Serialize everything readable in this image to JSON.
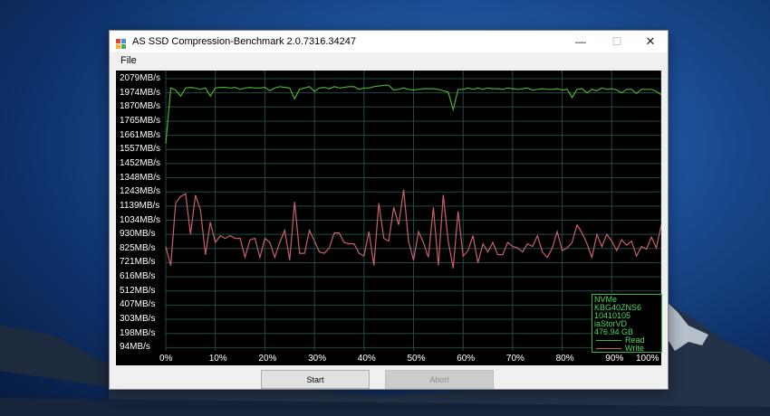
{
  "window": {
    "title": "AS SSD Compression-Benchmark 2.0.7316.34247",
    "controls": {
      "minimize": "—",
      "maximize": "☐",
      "close": "✕"
    }
  },
  "menu": {
    "file": "File"
  },
  "colors": {
    "read": "#4caf2f",
    "write": "#c9606a",
    "grid": "#1f4a45",
    "legend_text": "#4cd964"
  },
  "chart_data": {
    "type": "line",
    "x_unit": "% compression",
    "x": [
      0,
      1,
      2,
      3,
      4,
      5,
      6,
      7,
      8,
      9,
      10,
      11,
      12,
      13,
      14,
      15,
      16,
      17,
      18,
      19,
      20,
      21,
      22,
      23,
      24,
      25,
      26,
      27,
      28,
      29,
      30,
      31,
      32,
      33,
      34,
      35,
      36,
      37,
      38,
      39,
      40,
      41,
      42,
      43,
      44,
      45,
      46,
      47,
      48,
      49,
      50,
      51,
      52,
      53,
      54,
      55,
      56,
      57,
      58,
      59,
      60,
      61,
      62,
      63,
      64,
      65,
      66,
      67,
      68,
      69,
      70,
      71,
      72,
      73,
      74,
      75,
      76,
      77,
      78,
      79,
      80,
      81,
      82,
      83,
      84,
      85,
      86,
      87,
      88,
      89,
      90,
      91,
      92,
      93,
      94,
      95,
      96,
      97,
      98,
      99,
      100
    ],
    "y_ticks": [
      "2079MB/s",
      "1974MB/s",
      "1870MB/s",
      "1765MB/s",
      "1661MB/s",
      "1557MB/s",
      "1452MB/s",
      "1348MB/s",
      "1243MB/s",
      "1139MB/s",
      "1034MB/s",
      "930MB/s",
      "825MB/s",
      "721MB/s",
      "616MB/s",
      "512MB/s",
      "407MB/s",
      "303MB/s",
      "198MB/s",
      "94MB/s"
    ],
    "x_ticks": [
      "0%",
      "10%",
      "20%",
      "30%",
      "40%",
      "50%",
      "60%",
      "70%",
      "80%",
      "90%",
      "100%"
    ],
    "ylim": [
      0,
      2120
    ],
    "series": [
      {
        "name": "Read",
        "values": [
          1600,
          2010,
          1995,
          1950,
          2010,
          2015,
          2010,
          2000,
          2010,
          1950,
          2010,
          2015,
          2015,
          2010,
          2015,
          2000,
          2010,
          2015,
          2010,
          2010,
          2015,
          1990,
          2010,
          2020,
          2015,
          2010,
          1930,
          2000,
          2010,
          2020,
          1985,
          2010,
          2015,
          2005,
          2020,
          2010,
          2015,
          2020,
          2020,
          2000,
          2010,
          2010,
          2020,
          2025,
          2030,
          2030,
          1995,
          2000,
          2010,
          2000,
          1995,
          2000,
          2005,
          2005,
          2005,
          2000,
          1990,
          1980,
          1850,
          2000,
          2000,
          2010,
          2000,
          2010,
          2000,
          2010,
          2005,
          2005,
          2000,
          2010,
          2005,
          2000,
          2005,
          2010,
          1995,
          2000,
          2005,
          2000,
          2000,
          2005,
          1995,
          2000,
          1940,
          2000,
          2005,
          1975,
          2000,
          1990,
          2010,
          2000,
          2005,
          1995,
          1975,
          2000,
          2000,
          1970,
          2000,
          2000,
          2000,
          1985,
          1960
        ]
      },
      {
        "name": "Write",
        "values": [
          840,
          700,
          1160,
          1210,
          1230,
          930,
          1220,
          1110,
          780,
          1020,
          870,
          920,
          900,
          920,
          900,
          900,
          760,
          890,
          900,
          760,
          900,
          870,
          760,
          870,
          960,
          740,
          1170,
          790,
          790,
          960,
          880,
          800,
          790,
          830,
          940,
          940,
          870,
          860,
          860,
          790,
          770,
          950,
          700,
          1160,
          900,
          880,
          1130,
          1000,
          1260,
          880,
          740,
          950,
          870,
          760,
          1130,
          700,
          1220,
          880,
          680,
          1100,
          770,
          810,
          920,
          720,
          860,
          800,
          870,
          780,
          780,
          870,
          840,
          830,
          800,
          860,
          840,
          920,
          800,
          760,
          830,
          950,
          810,
          830,
          870,
          1000,
          940,
          860,
          760,
          930,
          840,
          930,
          880,
          810,
          890,
          850,
          880,
          770,
          840,
          820,
          910,
          830,
          1000
        ]
      }
    ],
    "legend_info": [
      "NVMe KBG40ZNS6",
      "10410105",
      "iaStorVD",
      "476.94 GB"
    ],
    "grid": true,
    "legend_position": "bottom-right"
  },
  "buttons": {
    "start": "Start",
    "abort": "Abort"
  }
}
